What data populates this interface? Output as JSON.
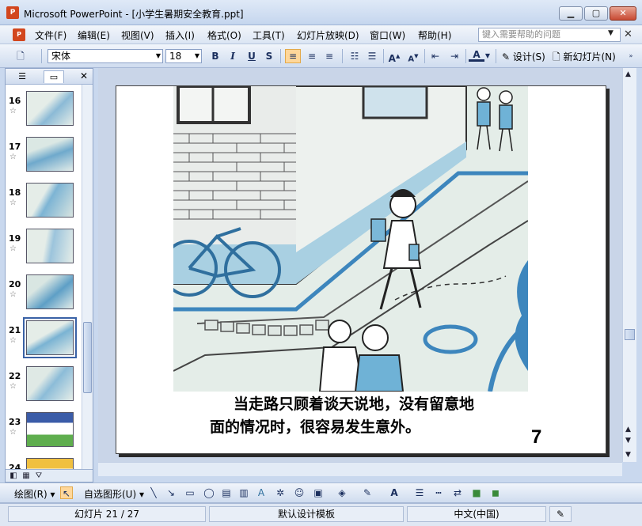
{
  "window": {
    "title": "Microsoft PowerPoint - [小学生暑期安全教育.ppt]",
    "app_badge": "P"
  },
  "menubar": {
    "items": [
      "文件(F)",
      "编辑(E)",
      "视图(V)",
      "插入(I)",
      "格式(O)",
      "工具(T)",
      "幻灯片放映(D)",
      "窗口(W)",
      "帮助(H)"
    ],
    "help_placeholder": "键入需要帮助的问题"
  },
  "toolbar": {
    "font_name": "宋体",
    "font_size": "18",
    "design_label": "设计(S)",
    "new_slide_label": "新幻灯片(N)"
  },
  "slides_pane": {
    "thumbnails": [
      {
        "number": "16"
      },
      {
        "number": "17"
      },
      {
        "number": "18"
      },
      {
        "number": "19"
      },
      {
        "number": "20"
      },
      {
        "number": "21",
        "selected": true
      },
      {
        "number": "22"
      },
      {
        "number": "23"
      },
      {
        "number": "24"
      }
    ]
  },
  "slide": {
    "caption_line1": "当走路只顾着谈天说地，没有留意地",
    "caption_line2": "面的情况时，很容易发生意外。",
    "number": "7"
  },
  "drawing_toolbar": {
    "draw_label": "绘图(R)",
    "autoshapes_label": "自选图形(U)"
  },
  "statusbar": {
    "slide_position": "幻灯片 21 / 27",
    "template": "默认设计模板",
    "language": "中文(中国)"
  },
  "colors": {
    "accent": "#3a62a6",
    "title_bar": "#c5d6ee",
    "illustration_blue": "#6fb2d6"
  }
}
